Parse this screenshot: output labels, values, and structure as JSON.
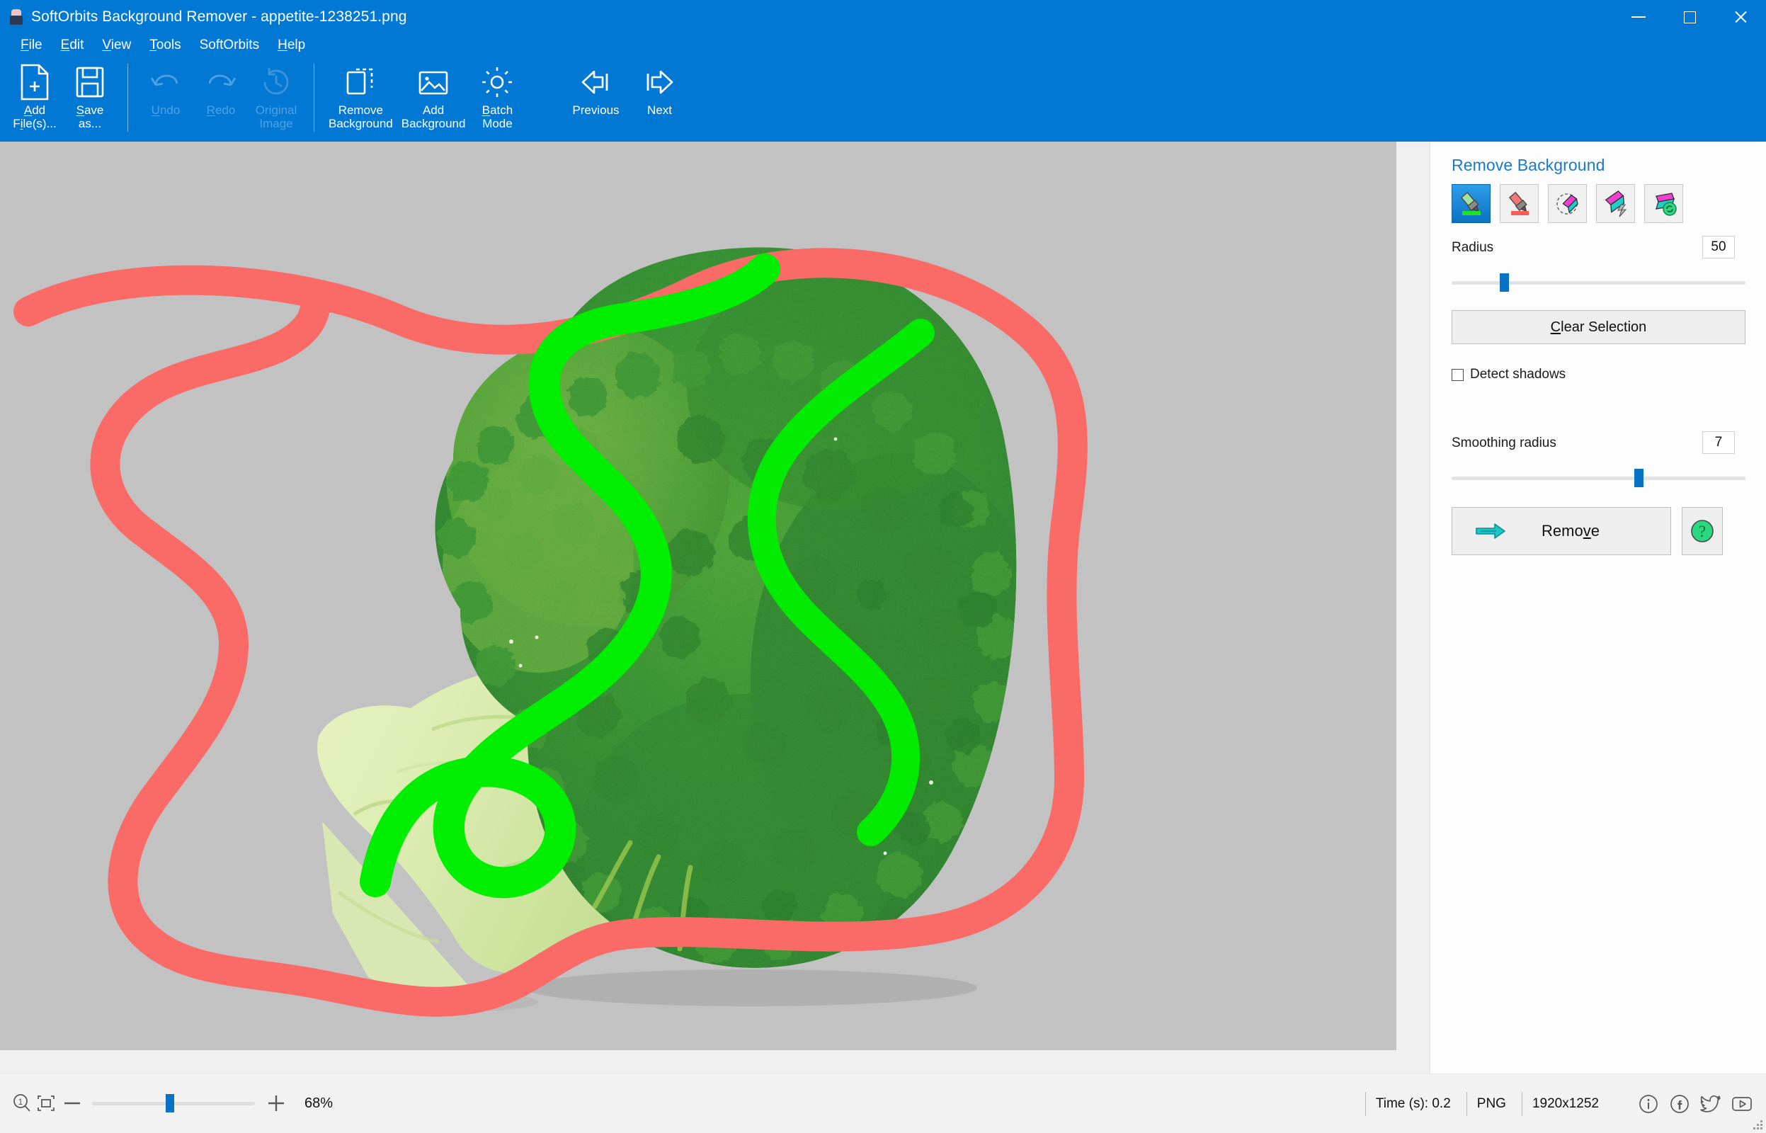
{
  "window": {
    "title": "SoftOrbits Background Remover - appetite-1238251.png",
    "app_icon": "app-icon",
    "minimize": "minimize",
    "maximize": "maximize",
    "close": "close"
  },
  "menu": {
    "items": [
      {
        "label": "File",
        "mnemonic": "F"
      },
      {
        "label": "Edit",
        "mnemonic": "E"
      },
      {
        "label": "View",
        "mnemonic": "V"
      },
      {
        "label": "Tools",
        "mnemonic": "T"
      },
      {
        "label": "SoftOrbits",
        "mnemonic": ""
      },
      {
        "label": "Help",
        "mnemonic": "H"
      }
    ]
  },
  "toolbar": {
    "buttons": [
      {
        "id": "add-files",
        "label": "Add\nFile(s)...",
        "icon": "file-plus-icon",
        "enabled": true
      },
      {
        "id": "save-as",
        "label": "Save\nas...",
        "icon": "floppy-save-icon",
        "enabled": true
      },
      {
        "id": "undo",
        "label": "Undo",
        "icon": "undo-arrow-icon",
        "enabled": false
      },
      {
        "id": "redo",
        "label": "Redo",
        "icon": "redo-arrow-icon",
        "enabled": false
      },
      {
        "id": "original-image",
        "label": "Original\nImage",
        "icon": "history-clock-icon",
        "enabled": false
      },
      {
        "id": "remove-background",
        "label": "Remove\nBackground",
        "icon": "marquee-select-icon",
        "enabled": true
      },
      {
        "id": "add-background",
        "label": "Add\nBackground",
        "icon": "picture-icon",
        "enabled": true
      },
      {
        "id": "batch-mode",
        "label": "Batch\nMode",
        "icon": "gear-icon",
        "enabled": true
      },
      {
        "id": "previous",
        "label": "Previous",
        "icon": "arrow-left-bar-icon",
        "enabled": true
      },
      {
        "id": "next",
        "label": "Next",
        "icon": "arrow-right-bar-icon",
        "enabled": true
      }
    ]
  },
  "panel": {
    "title": "Remove Background",
    "tools": [
      {
        "id": "mark-keep",
        "name": "green-marker-tool",
        "selected": true
      },
      {
        "id": "mark-remove",
        "name": "red-marker-tool",
        "selected": false
      },
      {
        "id": "eraser",
        "name": "eraser-tool",
        "selected": false
      },
      {
        "id": "magic-wand",
        "name": "magic-wand-tool",
        "selected": false
      },
      {
        "id": "restore",
        "name": "restore-tool",
        "selected": false
      }
    ],
    "radius": {
      "label": "Radius",
      "value": "50",
      "percent": 18
    },
    "clear_selection": {
      "label": "Clear Selection",
      "mnemonic": "C"
    },
    "detect_shadows": {
      "label": "Detect shadows",
      "checked": false
    },
    "smoothing_radius": {
      "label": "Smoothing radius",
      "value": "7",
      "percent": 66
    },
    "remove": {
      "label": "Remove",
      "mnemonic": "v",
      "icon": "double-arrow-right-icon"
    },
    "help": {
      "icon": "question-circle-icon"
    }
  },
  "canvas": {
    "background_color": "#c2c2c2",
    "keep_stroke_color": "#00ee00",
    "remove_stroke_color": "#fa6a66",
    "subject": "broccoli-photo"
  },
  "statusbar": {
    "zoom_100_icon": "zoom-100-icon",
    "fit_screen_icon": "fit-to-screen-icon",
    "zoom_out_icon": "zoom-out-icon",
    "zoom_in_icon": "zoom-in-icon",
    "zoom_percent": "68%",
    "zoom_slider_percent": 45,
    "time": "Time (s): 0.2",
    "format": "PNG",
    "dimensions": "1920x1252",
    "socials": [
      {
        "id": "info",
        "icon": "info-circle-icon"
      },
      {
        "id": "facebook",
        "icon": "facebook-icon"
      },
      {
        "id": "twitter",
        "icon": "twitter-bird-icon"
      },
      {
        "id": "youtube",
        "icon": "youtube-icon"
      }
    ]
  }
}
